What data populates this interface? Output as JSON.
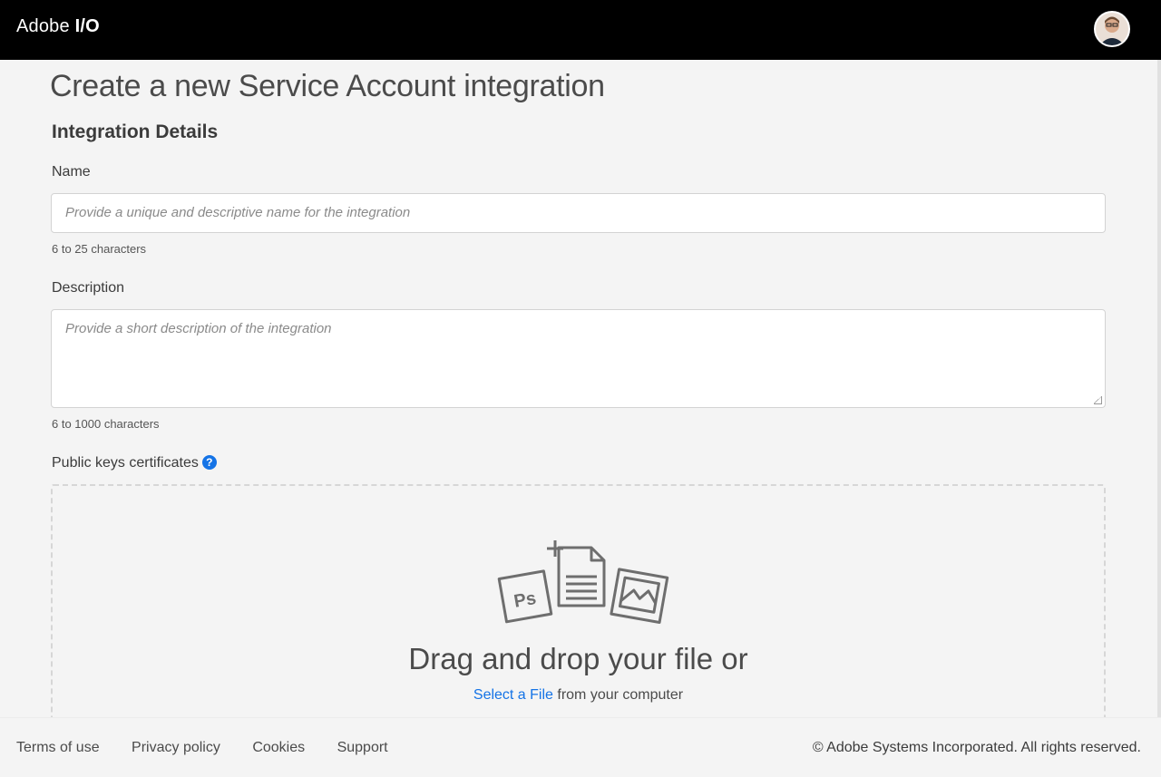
{
  "header": {
    "brand_light": "Adobe",
    "brand_bold": "I/O",
    "avatar_icon": "user-avatar"
  },
  "page": {
    "title": "Create a new Service Account integration",
    "section_title": "Integration Details"
  },
  "form": {
    "name": {
      "label": "Name",
      "value": "",
      "placeholder": "Provide a unique and descriptive name for the integration",
      "hint": "6 to 25 characters"
    },
    "description": {
      "label": "Description",
      "value": "",
      "placeholder": "Provide a short description of the integration",
      "hint": "6 to 1000 characters"
    },
    "public_keys": {
      "label": "Public keys certificates",
      "help_icon": "question-circle-icon",
      "help_glyph": "?"
    }
  },
  "dropzone": {
    "title": "Drag and drop your file or",
    "select_link": "Select a File",
    "suffix": " from your computer",
    "icon": "upload-files-icon"
  },
  "footer": {
    "links": [
      "Terms of use",
      "Privacy policy",
      "Cookies",
      "Support"
    ],
    "copyright": "© Adobe Systems Incorporated. All rights reserved."
  },
  "colors": {
    "topbar": "#000000",
    "background": "#f4f4f4",
    "link": "#1473e6"
  }
}
